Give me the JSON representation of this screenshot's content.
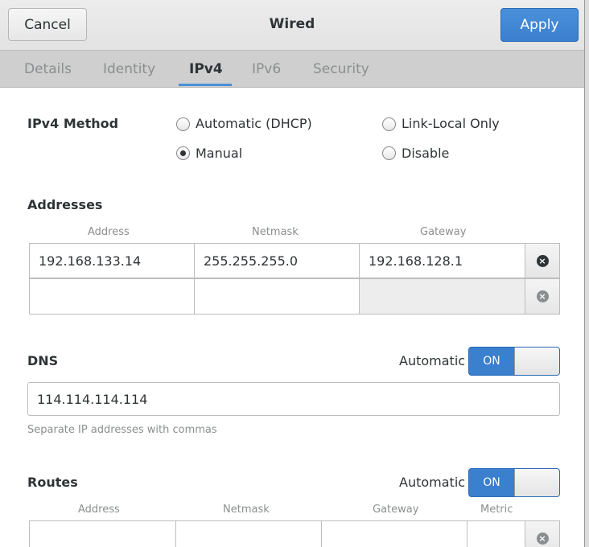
{
  "window": {
    "background_title_fragment": "Wired"
  },
  "header": {
    "cancel_label": "Cancel",
    "title": "Wired",
    "apply_label": "Apply"
  },
  "tabs": [
    {
      "label": "Details",
      "active": false
    },
    {
      "label": "Identity",
      "active": false
    },
    {
      "label": "IPv4",
      "active": true
    },
    {
      "label": "IPv6",
      "active": false
    },
    {
      "label": "Security",
      "active": false
    }
  ],
  "ipv4": {
    "method_label": "IPv4 Method",
    "methods": [
      {
        "label": "Automatic (DHCP)",
        "selected": false
      },
      {
        "label": "Link-Local Only",
        "selected": false
      },
      {
        "label": "Manual",
        "selected": true
      },
      {
        "label": "Disable",
        "selected": false
      }
    ],
    "addresses": {
      "heading": "Addresses",
      "columns": [
        "Address",
        "Netmask",
        "Gateway"
      ],
      "rows": [
        [
          "192.168.133.14",
          "255.255.255.0",
          "192.168.128.1"
        ],
        [
          "",
          "",
          ""
        ]
      ]
    },
    "dns": {
      "heading": "DNS",
      "automatic_label": "Automatic",
      "switch_state": "ON",
      "value": "114.114.114.114",
      "hint": "Separate IP addresses with commas"
    },
    "routes": {
      "heading": "Routes",
      "automatic_label": "Automatic",
      "switch_state": "ON",
      "columns": [
        "Address",
        "Netmask",
        "Gateway",
        "Metric"
      ]
    }
  },
  "colors": {
    "accent": "#4a90d9",
    "text": "#2e3436",
    "dim_text": "#8b8e8f"
  }
}
